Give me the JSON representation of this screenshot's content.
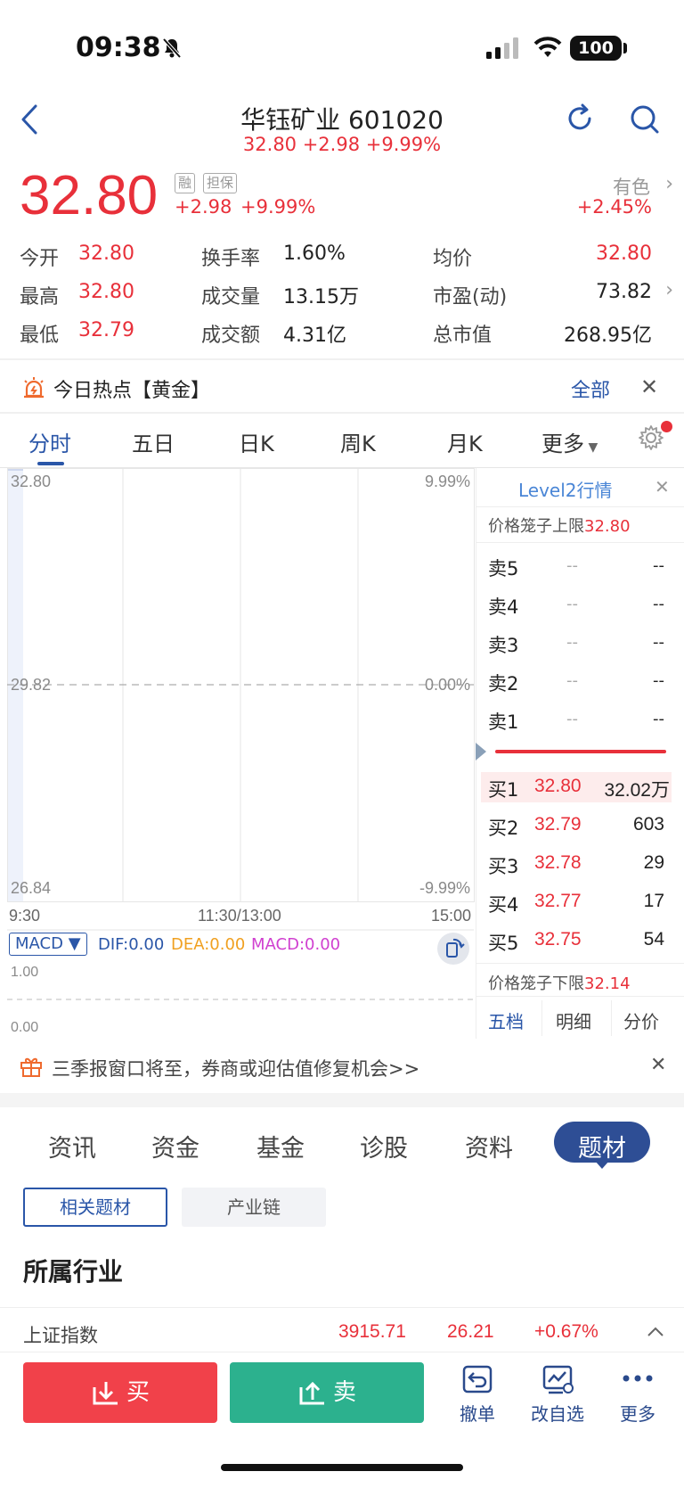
{
  "status_bar": {
    "time": "09:38",
    "battery": "100"
  },
  "nav": {
    "title": "华钰矿业 601020",
    "subtitle": "32.80 +2.98 +9.99%"
  },
  "quote": {
    "price": "32.80",
    "tags": [
      "融",
      "担保"
    ],
    "change": "+2.98",
    "change_pct": "+9.99%",
    "sector_name": "有色",
    "sector_pct": "+2.45%"
  },
  "stats": [
    {
      "label": "今开",
      "value": "32.80"
    },
    {
      "label": "换手率",
      "value": "1.60%"
    },
    {
      "label": "均价",
      "value": "32.80"
    },
    {
      "label": "最高",
      "value": "32.80"
    },
    {
      "label": "成交量",
      "value": "13.15万"
    },
    {
      "label": "市盈(动)",
      "value": "73.82"
    },
    {
      "label": "最低",
      "value": "32.79"
    },
    {
      "label": "成交额",
      "value": "4.31亿"
    },
    {
      "label": "总市值",
      "value": "268.95亿"
    }
  ],
  "hot": {
    "text": "今日热点【黄金】",
    "all": "全部"
  },
  "chart_tabs": [
    "分时",
    "五日",
    "日K",
    "周K",
    "月K",
    "更多"
  ],
  "chart": {
    "price_top": "32.80",
    "price_mid": "29.82",
    "price_bot": "26.84",
    "pct_top": "9.99%",
    "pct_mid": "0.00%",
    "pct_bot": "-9.99%",
    "time_start": "9:30",
    "time_mid": "11:30/13:00",
    "time_end": "15:00"
  },
  "macd": {
    "name": "MACD",
    "dif": "DIF:0.00",
    "dea": "DEA:0.00",
    "macd": "MACD:0.00",
    "axis_top": "1.00",
    "axis_bot": "0.00",
    "colors": {
      "dif": "#2a56a8",
      "dea": "#f0a020",
      "macd": "#d040d0"
    }
  },
  "level2": {
    "title": "Level2行情",
    "cage_upper_label": "价格笼子上限",
    "cage_upper": "32.80",
    "cage_lower_label": "价格笼子下限",
    "cage_lower": "32.14",
    "asks": [
      {
        "label": "卖5",
        "price": "--",
        "vol": "--"
      },
      {
        "label": "卖4",
        "price": "--",
        "vol": "--"
      },
      {
        "label": "卖3",
        "price": "--",
        "vol": "--"
      },
      {
        "label": "卖2",
        "price": "--",
        "vol": "--"
      },
      {
        "label": "卖1",
        "price": "--",
        "vol": "--"
      }
    ],
    "bids": [
      {
        "label": "买1",
        "price": "32.80",
        "vol": "32.02万"
      },
      {
        "label": "买2",
        "price": "32.79",
        "vol": "603"
      },
      {
        "label": "买3",
        "price": "32.78",
        "vol": "29"
      },
      {
        "label": "买4",
        "price": "32.77",
        "vol": "17"
      },
      {
        "label": "买5",
        "price": "32.75",
        "vol": "54"
      }
    ],
    "tabs": [
      "五档",
      "明细",
      "分价"
    ]
  },
  "banner": {
    "text": "三季报窗口将至，券商或迎估值修复机会>>"
  },
  "info_tabs": [
    "资讯",
    "资金",
    "基金",
    "诊股",
    "资料",
    "题材"
  ],
  "sub_tabs": [
    "相关题材",
    "产业链"
  ],
  "section_title": "所属行业",
  "index_row": {
    "name": "上证指数",
    "value": "3915.71",
    "change": "26.21",
    "pct": "+0.67%"
  },
  "trade": {
    "buy": "买",
    "sell": "卖",
    "actions": [
      "撤单",
      "改自选",
      "更多"
    ]
  },
  "colors": {
    "up": "#e8303a",
    "buy_btn": "#f1414a",
    "sell_btn": "#2cb18e",
    "accent": "#2a56a8"
  }
}
